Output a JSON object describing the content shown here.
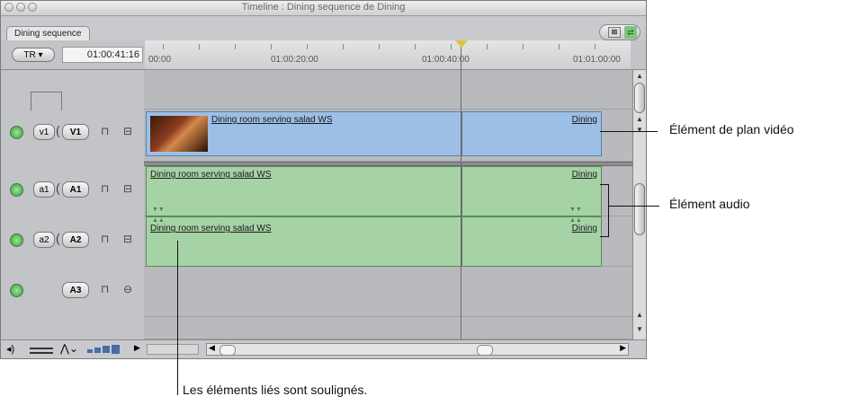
{
  "window": {
    "title": "Timeline : Dining sequence de Dining",
    "tab": "Dining sequence"
  },
  "controls": {
    "tr_button": "TR",
    "timecode": "01:00:41:16"
  },
  "ruler": {
    "labels": [
      "00:00",
      "01:00:20:00",
      "01:00:40:00",
      "01:01:00:00"
    ]
  },
  "tracks": {
    "video": [
      {
        "source": "v1",
        "dest": "V1"
      }
    ],
    "audio": [
      {
        "source": "a1",
        "dest": "A1"
      },
      {
        "source": "a2",
        "dest": "A2"
      },
      {
        "source": "",
        "dest": "A3"
      }
    ]
  },
  "clips": {
    "video_name": "Dining room serving salad WS",
    "video_next": "Dining",
    "audio1_name": "Dining room serving salad WS",
    "audio1_next": "Dining",
    "audio2_name": "Dining room serving salad WS",
    "audio2_next": "Dining"
  },
  "callouts": {
    "video_item": "Élément de plan vidéo",
    "audio_item": "Élément audio",
    "linked": "Les éléments liés sont soulignés."
  },
  "colors": {
    "video_clip": "#9dbfe5",
    "audio_clip": "#a6d3a6",
    "playhead": "#e2c23c"
  }
}
